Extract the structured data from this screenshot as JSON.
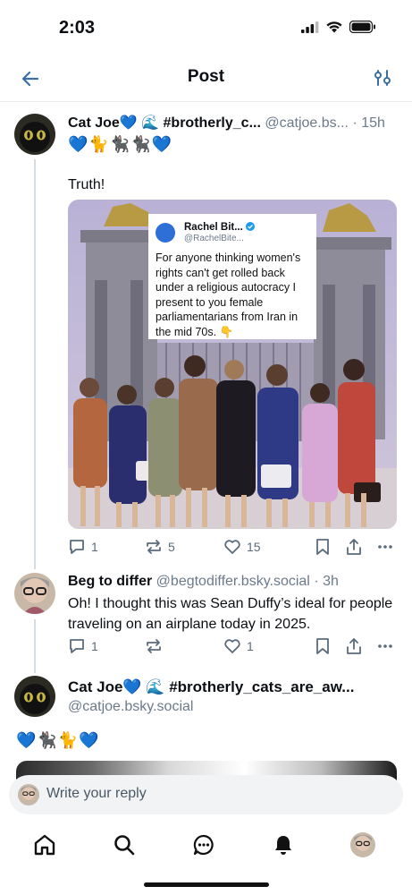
{
  "status": {
    "time": "2:03"
  },
  "header": {
    "title": "Post"
  },
  "main_post": {
    "author": "Cat Joe💙 🌊 #brotherly_c...",
    "handle": "@catjoe.bs...",
    "time": "· 15h",
    "display_emojis": [
      "💙",
      "🐈",
      "🐈‍⬛",
      "🐈‍⬛",
      "💙"
    ],
    "text": "Truth!",
    "image": {
      "quote_name": "Rachel Bit...",
      "quote_handle": "@RachelBite...",
      "quote_text": "For anyone thinking women's rights can't get rolled back under a religious autocracy I present to you female parliamentarians from Iran in the mid 70s. 👇"
    },
    "actions": {
      "replies": "1",
      "reposts": "5",
      "likes": "15"
    }
  },
  "reply_post": {
    "author": "Beg to differ",
    "handle": "@begtodiffer.bsky.social",
    "time": "· 3h",
    "text": "Oh! I thought this was Sean Duffy’s ideal for people traveling on an airplane today in 2025.",
    "actions": {
      "replies": "1",
      "reposts": "",
      "likes": "1"
    }
  },
  "third_post": {
    "author": "Cat Joe💙 🌊 #brotherly_cats_are_aw...",
    "handle": "@catjoe.bsky.social",
    "display_emojis": [
      "💙",
      "🐈‍⬛",
      "🐈",
      "💙"
    ]
  },
  "composer": {
    "placeholder": "Write your reply"
  },
  "colors": {
    "accent": "#1d8df2",
    "muted": "#6b7a8a",
    "thread_line": "#d4dbe2"
  }
}
